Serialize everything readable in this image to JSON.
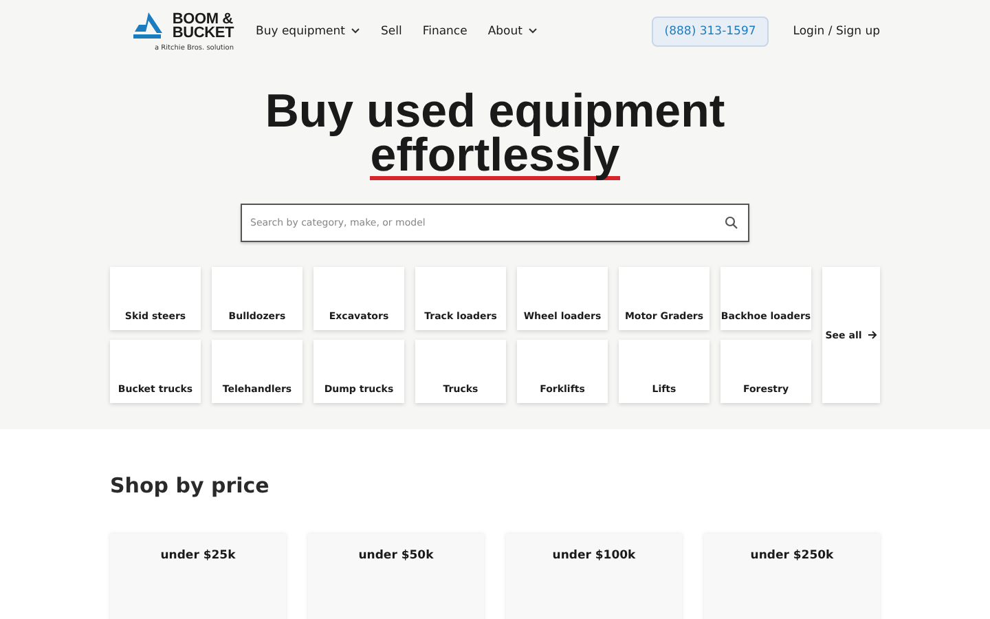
{
  "header": {
    "logo": {
      "line_1": "BOOM &",
      "line_2": "BUCKET",
      "tagline": "a Ritchie Bros. solution"
    },
    "nav": [
      {
        "label": "Buy equipment",
        "dropdown": true
      },
      {
        "label": "Sell",
        "dropdown": false
      },
      {
        "label": "Finance",
        "dropdown": false
      },
      {
        "label": "About",
        "dropdown": true
      }
    ],
    "phone": "(888) 313-1597",
    "login": "Login / Sign up"
  },
  "hero": {
    "title_line_1": "Buy used equipment",
    "title_line_2": "effortlessly",
    "search": {
      "placeholder": "Search by category, make, or model"
    },
    "categories": [
      "Skid steers",
      "Bulldozers",
      "Excavators",
      "Track loaders",
      "Wheel loaders",
      "Motor Graders",
      "Backhoe loaders",
      "Bucket trucks",
      "Telehandlers",
      "Dump trucks",
      "Trucks",
      "Forklifts",
      "Lifts",
      "Forestry"
    ],
    "see_all": "See all"
  },
  "shop_by_price": {
    "title": "Shop by price",
    "cards": [
      "under $25k",
      "under $50k",
      "under $100k",
      "under $250k"
    ]
  }
}
